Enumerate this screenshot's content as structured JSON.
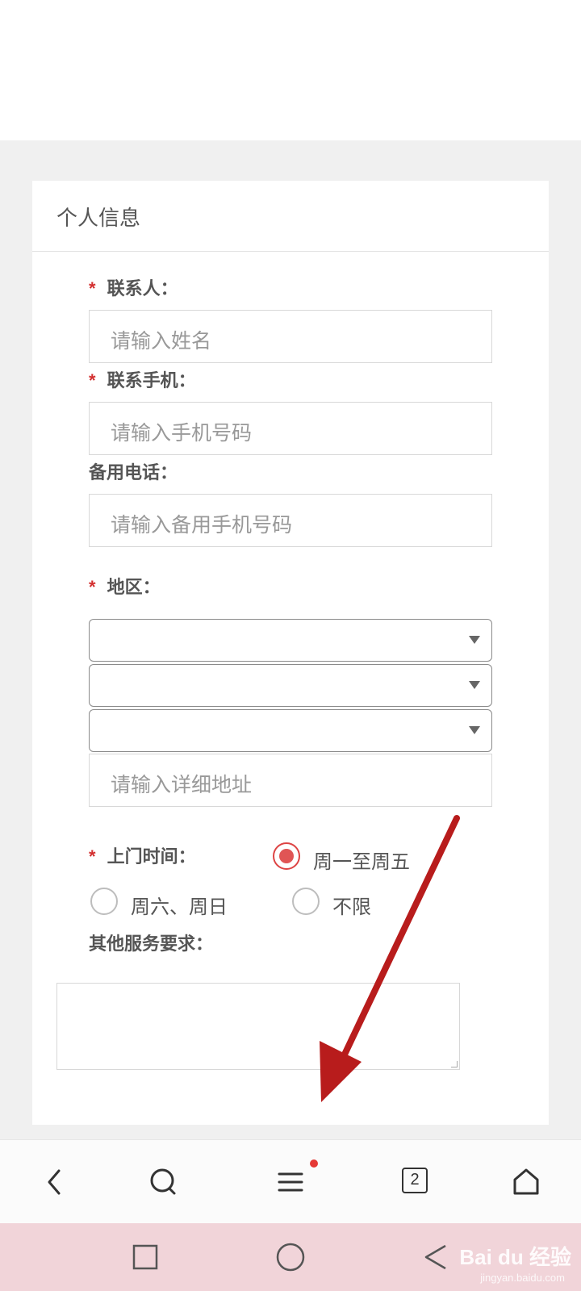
{
  "card": {
    "title": "个人信息"
  },
  "form": {
    "contact": {
      "required_mark": "*",
      "label": "联系人：",
      "placeholder": "请输入姓名"
    },
    "mobile": {
      "required_mark": "*",
      "label": "联系手机：",
      "placeholder": "请输入手机号码"
    },
    "backup_phone": {
      "label": "备用电话：",
      "placeholder": "请输入备用手机号码"
    },
    "region": {
      "required_mark": "*",
      "label": "地区：",
      "address_placeholder": "请输入详细地址"
    },
    "visit_time": {
      "required_mark": "*",
      "label": "上门时间：",
      "options": [
        "周一至周五",
        "周六、周日",
        "不限"
      ],
      "selected": "周一至周五"
    },
    "other": {
      "label": "其他服务要求："
    }
  },
  "browser_bar": {
    "tab_count": "2",
    "icons": [
      "back-icon",
      "search-icon",
      "menu-icon",
      "tabs-icon",
      "home-icon"
    ]
  },
  "system_nav": {
    "icons": [
      "recent-apps-icon",
      "home-circle-icon",
      "back-triangle-icon"
    ]
  },
  "watermark": {
    "brand": "Bai du 经验",
    "url": "jingyan.baidu.com"
  },
  "colors": {
    "required": "#d32f2f",
    "radio_selected": "#e05555",
    "annotation_arrow": "#b81c1c",
    "system_bar": "#f1d4d9"
  }
}
